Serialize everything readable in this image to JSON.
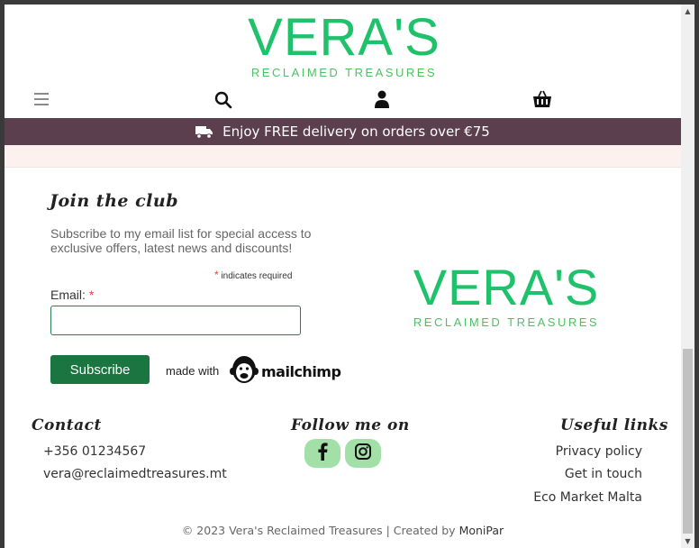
{
  "header": {
    "logo_title": "VERA'S",
    "logo_subtitle": "RECLAIMED TREASURES",
    "icons": [
      "hamburger-menu-icon",
      "search-icon",
      "user-icon",
      "basket-icon"
    ]
  },
  "promo": {
    "text": "Enjoy FREE delivery on orders over €75",
    "icon": "truck-icon"
  },
  "join": {
    "title": "Join the club",
    "description": "Subscribe to my email list for special access to exclusive offers, latest news and discounts!",
    "required_star": "*",
    "required_note": "indicates required",
    "email_label": "Email:",
    "email_value": "",
    "subscribe_label": "Subscribe",
    "made_with": "made with",
    "mailchimp": "mailchimp"
  },
  "side_logo": {
    "title": "VERA'S",
    "subtitle": "RECLAIMED TREASURES"
  },
  "footer": {
    "contact_title": "Contact",
    "phone": "+356 01234567",
    "email": "vera@reclaimedtreasures.mt",
    "follow_title": "Follow me on",
    "socials": [
      "facebook-icon",
      "instagram-icon"
    ],
    "useful_title": "Useful links",
    "links": [
      "Privacy policy",
      "Get in touch",
      "Eco Market Malta"
    ],
    "copyright": "© 2023 Vera's Reclaimed Treasures | Created by ",
    "creator": "MoniPar"
  },
  "colors": {
    "logo_green": "#1fc26a",
    "promo_bar": "#5c3f4f",
    "subscribe_button": "#1a7541",
    "social_bg": "#a3e0a8",
    "required_star": "#e5452b"
  }
}
